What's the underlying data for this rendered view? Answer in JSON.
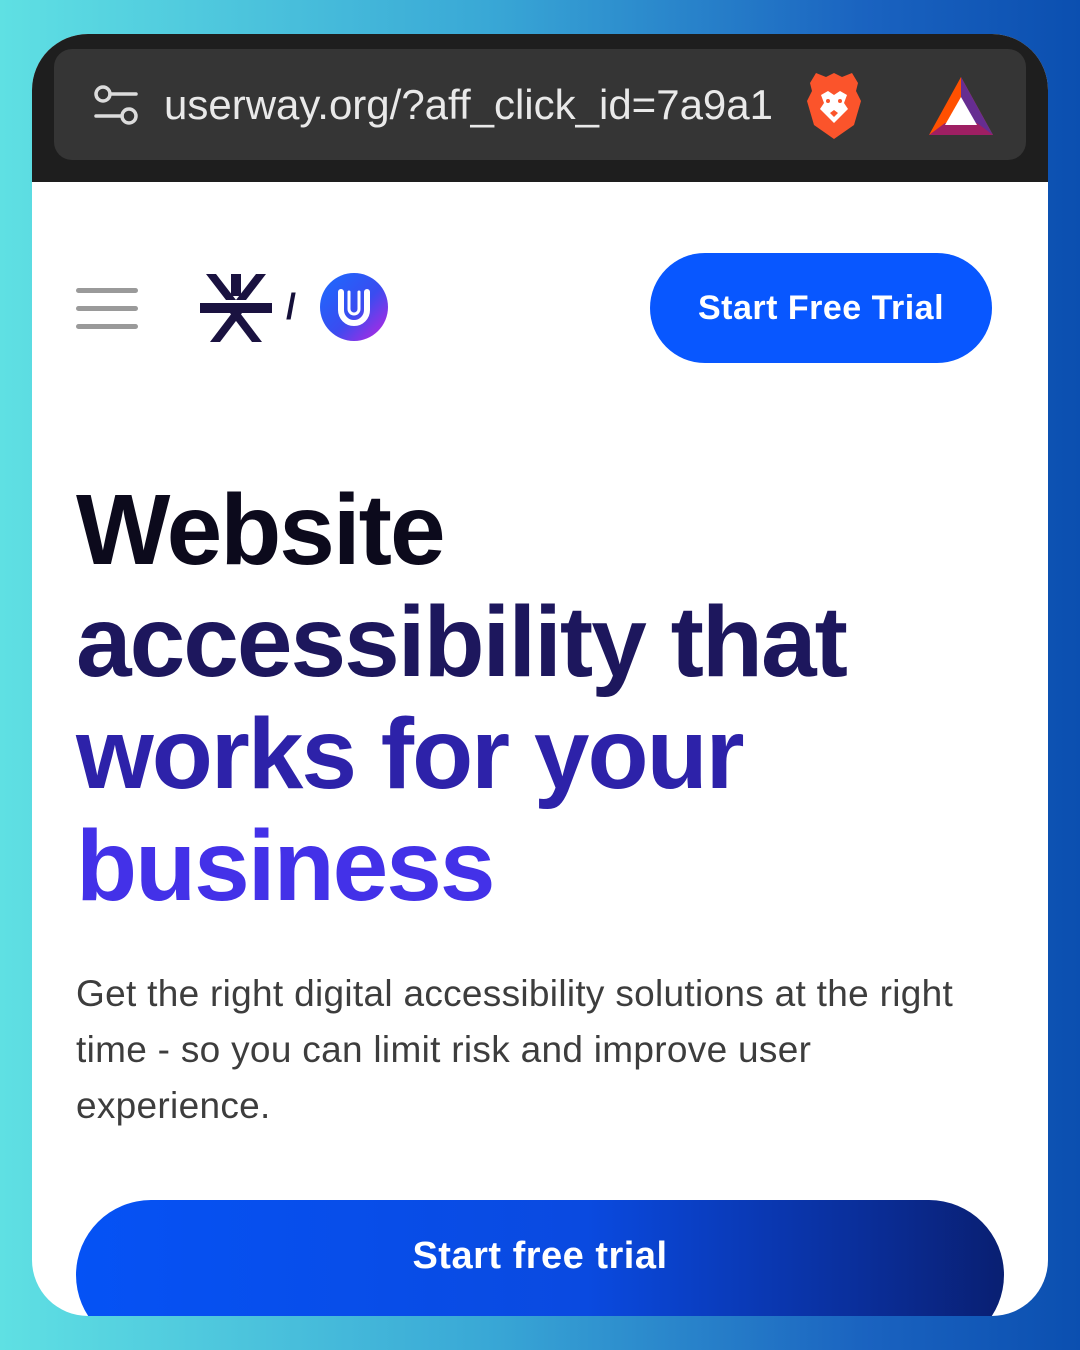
{
  "browser": {
    "url": "userway.org/?aff_click_id=7a9a1",
    "icons": [
      "tune-icon",
      "brave-lion-icon",
      "bat-triangle-icon"
    ]
  },
  "header": {
    "logos": [
      "level-access-logo",
      "userway-logo"
    ],
    "divider": "/",
    "cta_label": "Start Free Trial"
  },
  "hero": {
    "headline_lines": [
      "Website",
      "accessibility that",
      "works for your",
      "business"
    ],
    "subtext": "Get the right digital accessibility solutions at the right time - so you can limit risk and improve user experience.",
    "cta_label": "Start free trial"
  },
  "colors": {
    "accent": "#0857ff",
    "headline_dark": "#0c0a1c",
    "headline_purple": "#4331e8",
    "browser_bar": "#1e1e1e"
  }
}
